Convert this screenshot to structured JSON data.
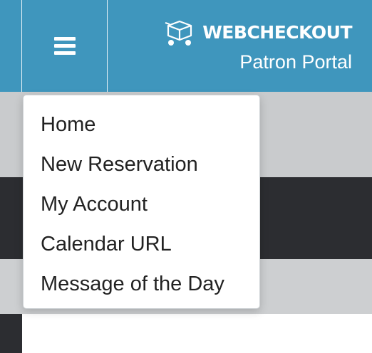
{
  "header": {
    "brand_name": "WEBCHECKOUT",
    "brand_subtitle": "Patron Portal",
    "logo_icon": "cart-icon",
    "menu_icon": "hamburger-icon"
  },
  "menu": {
    "items": [
      {
        "label": "Home"
      },
      {
        "label": "New Reservation"
      },
      {
        "label": "My Account"
      },
      {
        "label": "Calendar URL"
      },
      {
        "label": "Message of the Day"
      }
    ]
  },
  "colors": {
    "header_bg": "#3f96bd",
    "gray_band": "#c9cbcd",
    "dark_band": "#2c2d31"
  }
}
